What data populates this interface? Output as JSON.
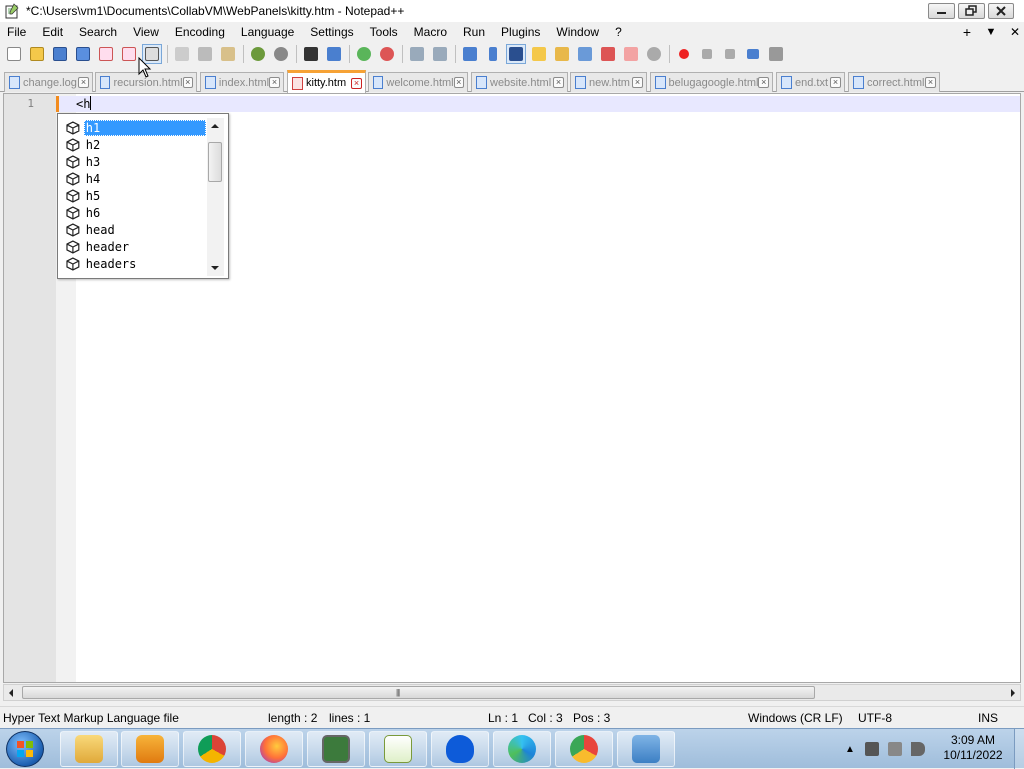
{
  "window": {
    "title": "*C:\\Users\\vm1\\Documents\\CollabVM\\WebPanels\\kitty.htm - Notepad++",
    "controls": [
      "minimize",
      "maximize",
      "close"
    ]
  },
  "menubar": {
    "items": [
      "File",
      "Edit",
      "Search",
      "View",
      "Encoding",
      "Language",
      "Settings",
      "Tools",
      "Macro",
      "Run",
      "Plugins",
      "Window",
      "?"
    ],
    "right": [
      "+",
      "▼",
      "✕"
    ]
  },
  "toolbar": {
    "icons": [
      "new-file-icon",
      "open-file-icon",
      "save-icon",
      "save-all-icon",
      "close-icon",
      "close-all-icon",
      "print-icon",
      "cut-icon",
      "copy-icon",
      "paste-icon",
      "undo-icon",
      "redo-icon",
      "find-icon",
      "replace-icon",
      "zoom-in-icon",
      "zoom-out-icon",
      "sync-v-icon",
      "sync-h-icon",
      "word-wrap-icon",
      "show-all-chars-icon",
      "indent-guide-icon",
      "doc-map-icon",
      "function-list-icon",
      "folder-as-workspace-icon",
      "monitoring-icon",
      "record-macro-icon",
      "stop-record-icon",
      "play-macro-icon",
      "run-macro-multiple-icon",
      "save-macro-icon"
    ]
  },
  "tabs": [
    {
      "label": "change.log",
      "active": false
    },
    {
      "label": "recursion.html",
      "active": false
    },
    {
      "label": "index.html",
      "active": false
    },
    {
      "label": "kitty.htm",
      "active": true
    },
    {
      "label": "welcome.html",
      "active": false
    },
    {
      "label": "website.html",
      "active": false
    },
    {
      "label": "new.htm",
      "active": false
    },
    {
      "label": "belugagoogle.html",
      "active": false
    },
    {
      "label": "end.txt",
      "active": false
    },
    {
      "label": "correct.html",
      "active": false
    }
  ],
  "editor": {
    "line_number": "1",
    "code": "<h"
  },
  "autocomplete": {
    "selected": "h1",
    "items": [
      "h1",
      "h2",
      "h3",
      "h4",
      "h5",
      "h6",
      "head",
      "header",
      "headers"
    ]
  },
  "statusbar": {
    "filetype": "Hyper Text Markup Language file",
    "length": "length : 2",
    "lines": "lines : 1",
    "ln": "Ln : 1",
    "col": "Col : 3",
    "pos": "Pos : 3",
    "eol": "Windows (CR LF)",
    "encoding": "UTF-8",
    "mode": "INS"
  },
  "taskbar": {
    "apps": [
      "file-explorer",
      "media-player",
      "chrome",
      "firefox",
      "task-manager",
      "notepad-plus-plus",
      "malwarebytes",
      "edge",
      "chrome-canary",
      "control-panel"
    ],
    "time": "3:09 AM",
    "date": "10/11/2022"
  },
  "colors": {
    "selection": "#3399ff",
    "active_tab_accent": "#f6a235",
    "current_line": "#e8e8ff",
    "taskbar": "#a9c4e0"
  }
}
